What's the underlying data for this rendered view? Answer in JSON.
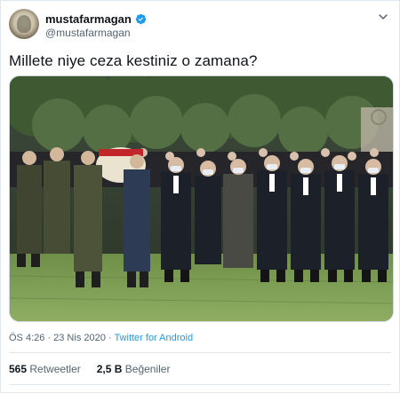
{
  "user": {
    "display_name": "mustafarmagan",
    "handle": "@mustafarmagan",
    "verified": true,
    "verified_color": "#1d9bf0"
  },
  "tweet": {
    "text": "Millete niye ceza kestiniz o zamana?",
    "media_description": "Ceremony procession of officials and soldiers walking on grass in front of trees"
  },
  "meta": {
    "time": "ÖS 4:26",
    "separator": " · ",
    "date": "23 Nis 2020",
    "source": "Twitter for Android"
  },
  "stats": {
    "retweets_count": "565",
    "retweets_label": "Retweetler",
    "likes_count": "2,5 B",
    "likes_label": "Beğeniler"
  },
  "icons": {
    "verified": "verified-badge-icon",
    "caret": "chevron-down-icon"
  },
  "colors": {
    "link": "#1d9bf0",
    "secondary_text": "#536471",
    "primary_text": "#0f1419"
  }
}
